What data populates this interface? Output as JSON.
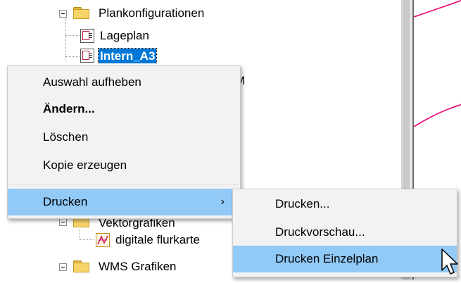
{
  "tree": {
    "items": [
      {
        "label": "Plankonfigurationen"
      },
      {
        "label": "Lageplan"
      },
      {
        "label": "Intern_A3"
      },
      {
        "label": "M"
      },
      {
        "label": "Vektorgrafiken"
      },
      {
        "label": "digitale flurkarte"
      },
      {
        "label": "WMS Grafiken"
      }
    ]
  },
  "context_menu": {
    "items": [
      {
        "label": "Auswahl aufheben"
      },
      {
        "label": "Ändern..."
      },
      {
        "label": "Löschen"
      },
      {
        "label": "Kopie erzeugen"
      },
      {
        "label": "Drucken",
        "arrow": "›"
      }
    ]
  },
  "submenu": {
    "items": [
      {
        "label": "Drucken..."
      },
      {
        "label": "Druckvorschau..."
      },
      {
        "label": "Drucken Einzelplan"
      }
    ]
  },
  "colors": {
    "selection": "#0078d7",
    "menu_highlight": "#91c9f7",
    "plot_line": "#e8177f"
  }
}
